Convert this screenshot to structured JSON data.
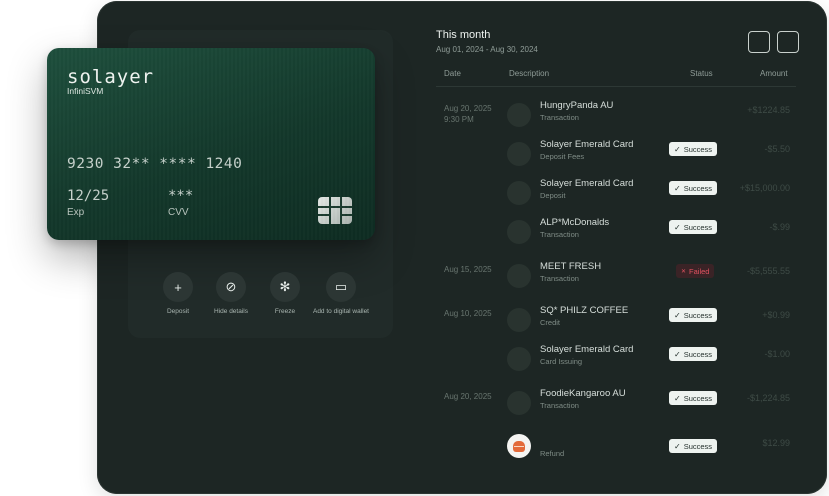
{
  "card": {
    "brand": "solayer",
    "sub_brand": "InfiniSVM",
    "number": "9230 32** **** 1240",
    "exp_value": "12/25",
    "exp_label": "Exp",
    "cvv_value": "***",
    "cvv_label": "CVV"
  },
  "actions": [
    {
      "label": "Deposit",
      "icon": "+"
    },
    {
      "label": "Hide details",
      "icon": "⊘"
    },
    {
      "label": "Freeze",
      "icon": "✻"
    },
    {
      "label": "Add to digital wallet",
      "icon": "▭"
    }
  ],
  "header": {
    "title": "This month",
    "range": "Aug 01, 2024 - Aug 30, 2024"
  },
  "columns": {
    "date": "Date",
    "description": "Description",
    "status": "Status",
    "amount": "Amount"
  },
  "transactions": [
    {
      "date": "Aug 20, 2025",
      "time": "9:30 PM",
      "title": "HungryPanda AU",
      "subtitle": "Transaction",
      "status": "",
      "amount": "+$1224.85"
    },
    {
      "date": "",
      "time": "",
      "title": "Solayer Emerald Card",
      "subtitle": "Deposit Fees",
      "status": "Success",
      "amount": "-$5.50"
    },
    {
      "date": "",
      "time": "",
      "title": "Solayer Emerald Card",
      "subtitle": "Deposit",
      "status": "Success",
      "amount": "+$15,000.00"
    },
    {
      "date": "",
      "time": "",
      "title": "ALP*McDonalds",
      "subtitle": "Transaction",
      "status": "Success",
      "amount": "-$.99"
    },
    {
      "date": "Aug 15, 2025",
      "time": "",
      "title": "MEET FRESH",
      "subtitle": "Transaction",
      "status": "Failed",
      "amount": "-$5,555.55"
    },
    {
      "date": "Aug 10, 2025",
      "time": "",
      "title": "SQ* PHILZ COFFEE",
      "subtitle": "Credit",
      "status": "Success",
      "amount": "+$0.99"
    },
    {
      "date": "",
      "time": "",
      "title": "Solayer Emerald Card",
      "subtitle": "Card Issuing",
      "status": "Success",
      "amount": "-$1.00"
    },
    {
      "date": "Aug 20, 2025",
      "time": "",
      "title": "FoodieKangaroo AU",
      "subtitle": "Transaction",
      "status": "Success",
      "amount": "-$1,224.85"
    },
    {
      "date": "",
      "time": "",
      "title": "",
      "subtitle": "Refund",
      "status": "Success",
      "amount": "$12.99"
    }
  ],
  "icons": {
    "success": "check-icon",
    "failed": "x-icon",
    "refund_avatar": "burger-icon"
  }
}
